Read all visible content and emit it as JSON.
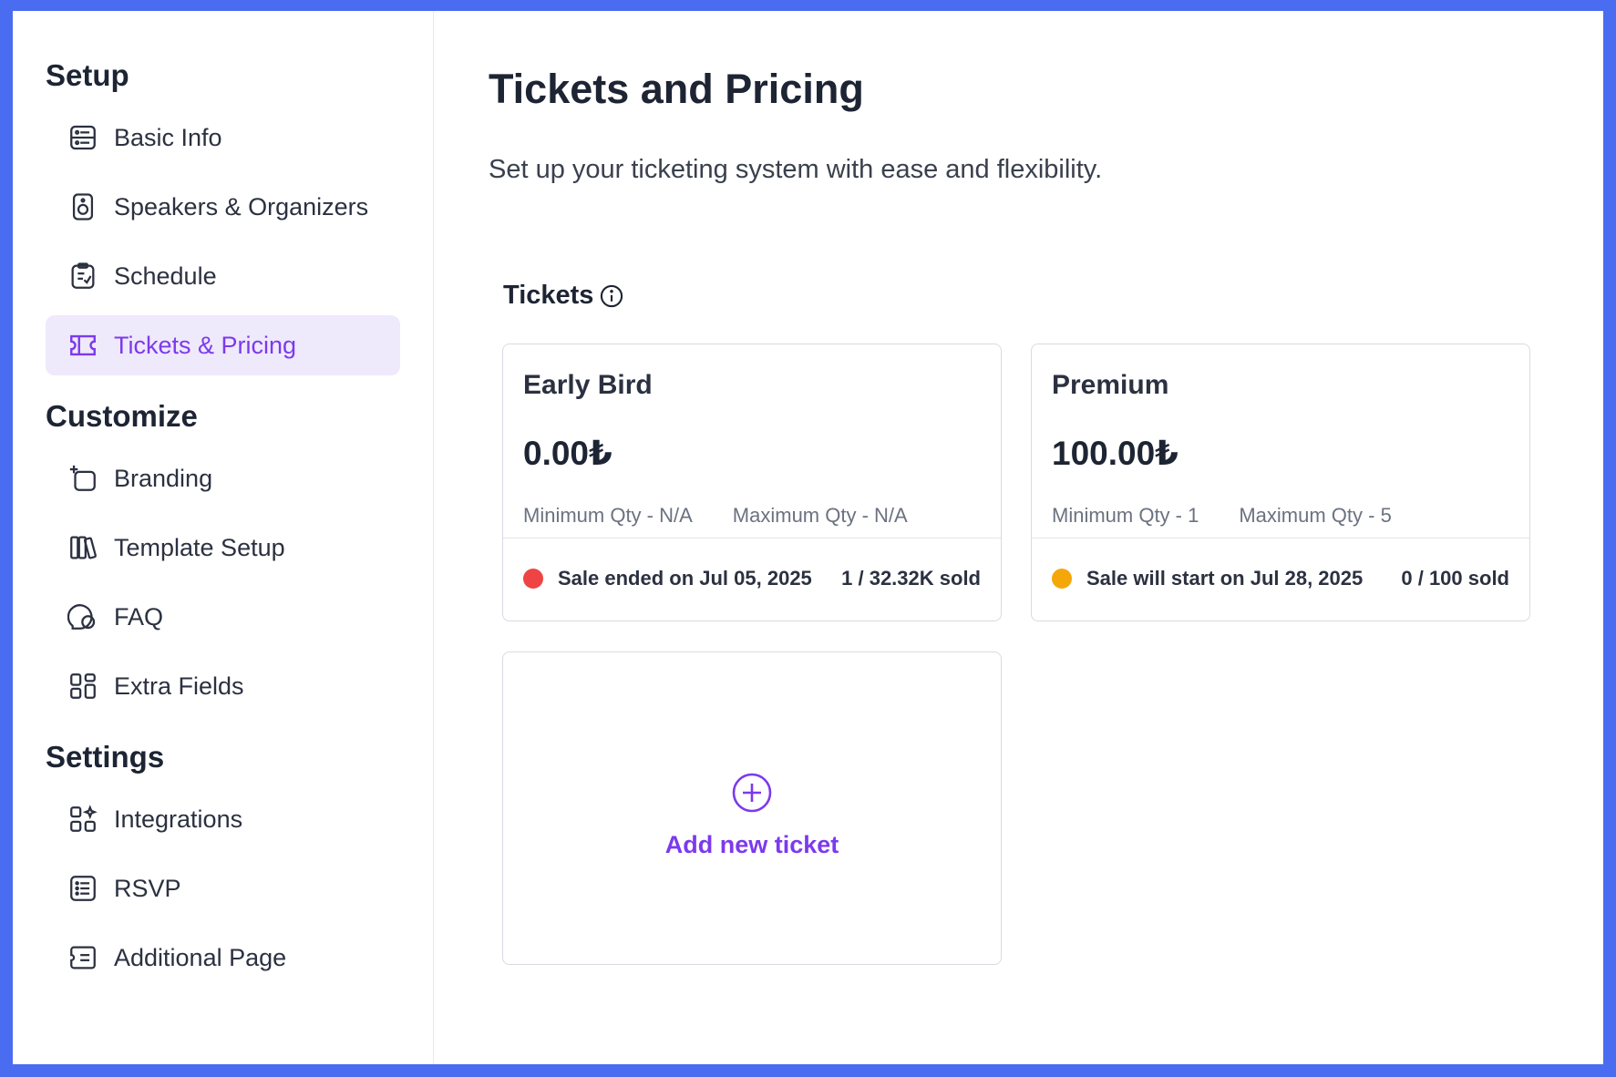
{
  "sidebar": {
    "sections": [
      {
        "title": "Setup"
      },
      {
        "title": "Customize"
      },
      {
        "title": "Settings"
      }
    ],
    "items": [
      {
        "label": "Basic Info",
        "icon": "basic-info-icon"
      },
      {
        "label": "Speakers & Organizers",
        "icon": "speaker-icon"
      },
      {
        "label": "Schedule",
        "icon": "schedule-icon"
      },
      {
        "label": "Tickets & Pricing",
        "icon": "ticket-icon",
        "active": true
      },
      {
        "label": "Branding",
        "icon": "branding-icon"
      },
      {
        "label": "Template Setup",
        "icon": "template-icon"
      },
      {
        "label": "FAQ",
        "icon": "faq-icon"
      },
      {
        "label": "Extra Fields",
        "icon": "extra-fields-icon"
      },
      {
        "label": "Integrations",
        "icon": "integrations-icon"
      },
      {
        "label": "RSVP",
        "icon": "rsvp-icon"
      },
      {
        "label": "Additional Page",
        "icon": "additional-page-icon"
      }
    ]
  },
  "main": {
    "title": "Tickets and Pricing",
    "subtitle": "Set up your ticketing system with ease and flexibility.",
    "tickets_heading": "Tickets",
    "tickets": [
      {
        "name": "Early Bird",
        "price": "0.00₺",
        "min_qty": "Minimum Qty - N/A",
        "max_qty": "Maximum Qty - N/A",
        "status": "Sale ended on Jul 05, 2025",
        "status_color": "#ef4444",
        "sold": "1 / 32.32K sold"
      },
      {
        "name": "Premium",
        "price": "100.00₺",
        "min_qty": "Minimum Qty - 1",
        "max_qty": "Maximum Qty - 5",
        "status": "Sale will start on Jul 28, 2025",
        "status_color": "#f5a70a",
        "sold": "0 / 100 sold"
      }
    ],
    "add_ticket_label": "Add new ticket"
  },
  "colors": {
    "accent": "#7c3aed",
    "active_bg": "#efe9fc",
    "frame_bg": "#4a6cf0"
  }
}
